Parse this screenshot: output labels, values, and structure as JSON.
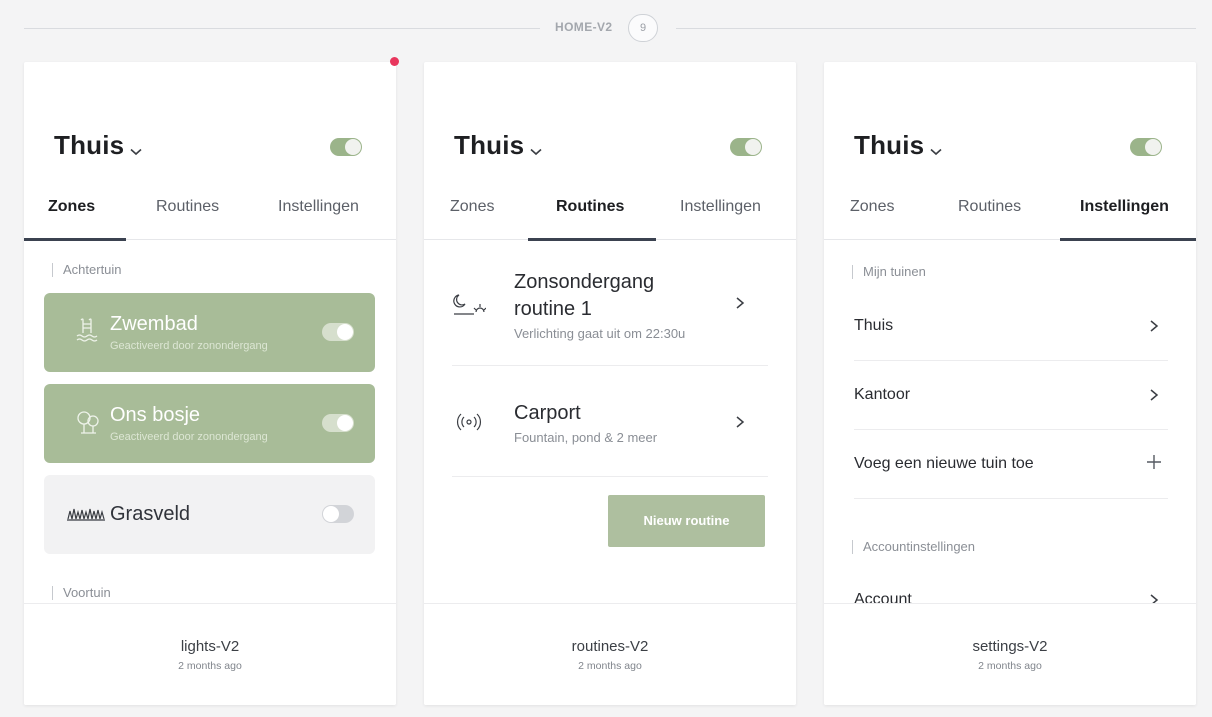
{
  "section": {
    "title": "HOME-V2",
    "count": "9"
  },
  "cards": {
    "lights": {
      "footer": {
        "name": "lights-V2",
        "ago": "2 months ago"
      },
      "header": {
        "title": "Thuis"
      },
      "tabs": [
        "Zones",
        "Routines",
        "Instellingen"
      ],
      "groups": [
        "Achtertuin",
        "Voortuin"
      ],
      "zones": [
        {
          "name": "Zwembad",
          "sub": "Geactiveerd door zonondergang",
          "state": "on",
          "icon": "pool-icon"
        },
        {
          "name": "Ons bosje",
          "sub": "Geactiveerd door zonondergang",
          "state": "on",
          "icon": "trees-icon"
        },
        {
          "name": "Grasveld",
          "sub": "",
          "state": "off",
          "icon": "grass-icon"
        }
      ]
    },
    "routines": {
      "footer": {
        "name": "routines-V2",
        "ago": "2 months ago"
      },
      "header": {
        "title": "Thuis"
      },
      "tabs": [
        "Zones",
        "Routines",
        "Instellingen"
      ],
      "items": [
        {
          "title_line1": "Zonsondergang",
          "title_line2": "routine 1",
          "sub": "Verlichting gaat uit om 22:30u",
          "icon": "sunset-icon"
        },
        {
          "title_line1": "Carport",
          "title_line2": "",
          "sub": "Fountain, pond & 2 meer",
          "icon": "signal-icon"
        }
      ],
      "new_button": "Nieuw routine"
    },
    "settings": {
      "footer": {
        "name": "settings-V2",
        "ago": "2 months ago"
      },
      "header": {
        "title": "Thuis"
      },
      "tabs": [
        "Zones",
        "Routines",
        "Instellingen"
      ],
      "groups": [
        "Mijn tuinen",
        "Accountinstellingen"
      ],
      "gardens": [
        "Thuis",
        "Kantoor"
      ],
      "add_garden": "Voeg een nieuwe tuin toe",
      "account": "Account"
    }
  },
  "colors": {
    "accent": "#a8bc98",
    "notification": "#e8365d",
    "tab_underline": "#3b4250"
  }
}
